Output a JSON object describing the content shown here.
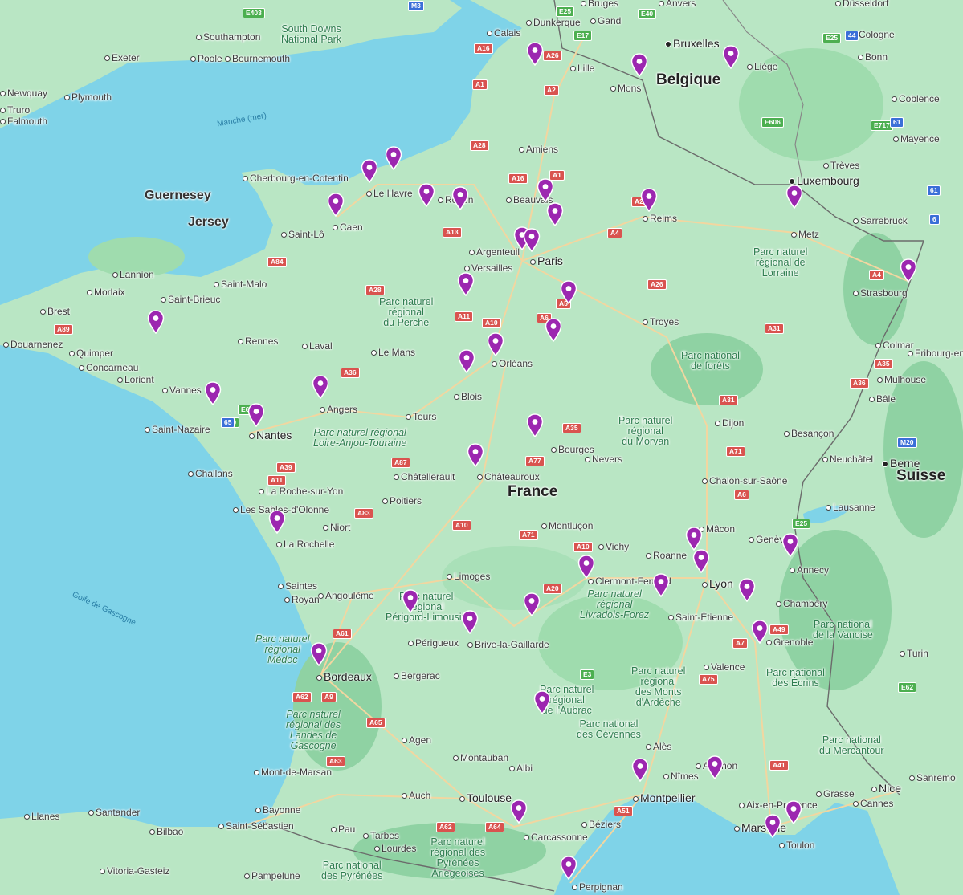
{
  "map": {
    "countries": [
      {
        "name": "France"
      },
      {
        "name": "Belgique"
      },
      {
        "name": "Suisse"
      }
    ],
    "islands": [
      {
        "name": "Guernesey"
      },
      {
        "name": "Jersey"
      }
    ],
    "cities": [
      {
        "name": "Paris",
        "style": "big"
      },
      {
        "name": "Lyon",
        "style": "big"
      },
      {
        "name": "Marseille",
        "style": "big"
      },
      {
        "name": "Toulouse",
        "style": "big"
      },
      {
        "name": "Nantes",
        "style": "big"
      },
      {
        "name": "Bordeaux",
        "style": "big"
      },
      {
        "name": "Montpellier",
        "style": "big"
      },
      {
        "name": "Nice",
        "style": "big"
      },
      {
        "name": "Bruxelles",
        "style": "cap"
      },
      {
        "name": "Luxembourg",
        "style": "cap"
      },
      {
        "name": "Berne",
        "style": "cap"
      },
      {
        "name": "Lille"
      },
      {
        "name": "Rouen"
      },
      {
        "name": "Le Havre"
      },
      {
        "name": "Caen"
      },
      {
        "name": "Reims"
      },
      {
        "name": "Metz"
      },
      {
        "name": "Strasbourg"
      },
      {
        "name": "Amiens"
      },
      {
        "name": "Calais"
      },
      {
        "name": "Dunkerque"
      },
      {
        "name": "Gand"
      },
      {
        "name": "Anvers"
      },
      {
        "name": "Bruges"
      },
      {
        "name": "Mons"
      },
      {
        "name": "Liège"
      },
      {
        "name": "Düsseldorf"
      },
      {
        "name": "Cologne"
      },
      {
        "name": "Bonn"
      },
      {
        "name": "Coblence"
      },
      {
        "name": "Mayence"
      },
      {
        "name": "Trèves"
      },
      {
        "name": "Sarrebruck"
      },
      {
        "name": "Cherbourg-en-Cotentin"
      },
      {
        "name": "Saint-Lô"
      },
      {
        "name": "Beauvais"
      },
      {
        "name": "Argenteuil"
      },
      {
        "name": "Versailles"
      },
      {
        "name": "Troyes"
      },
      {
        "name": "Orléans"
      },
      {
        "name": "Blois"
      },
      {
        "name": "Tours"
      },
      {
        "name": "Le Mans"
      },
      {
        "name": "Laval"
      },
      {
        "name": "Rennes"
      },
      {
        "name": "Angers"
      },
      {
        "name": "Brest"
      },
      {
        "name": "Morlaix"
      },
      {
        "name": "Lannion"
      },
      {
        "name": "Saint-Brieuc"
      },
      {
        "name": "Saint-Malo"
      },
      {
        "name": "Quimper"
      },
      {
        "name": "Concarneau"
      },
      {
        "name": "Lorient"
      },
      {
        "name": "Vannes"
      },
      {
        "name": "Douarnenez"
      },
      {
        "name": "Saint-Nazaire"
      },
      {
        "name": "Challans"
      },
      {
        "name": "La Roche-sur-Yon"
      },
      {
        "name": "Les Sables-d'Olonne"
      },
      {
        "name": "La Rochelle"
      },
      {
        "name": "Niort"
      },
      {
        "name": "Poitiers"
      },
      {
        "name": "Châtellerault"
      },
      {
        "name": "Châteauroux"
      },
      {
        "name": "Bourges"
      },
      {
        "name": "Nevers"
      },
      {
        "name": "Dijon"
      },
      {
        "name": "Besançon"
      },
      {
        "name": "Colmar"
      },
      {
        "name": "Mulhouse"
      },
      {
        "name": "Bâle"
      },
      {
        "name": "Fribourg-en-B."
      },
      {
        "name": "Neuchâtel"
      },
      {
        "name": "Lausanne"
      },
      {
        "name": "Genève"
      },
      {
        "name": "Annecy"
      },
      {
        "name": "Chambéry"
      },
      {
        "name": "Grenoble"
      },
      {
        "name": "Turin"
      },
      {
        "name": "Valence"
      },
      {
        "name": "Saint-Étienne"
      },
      {
        "name": "Roanne"
      },
      {
        "name": "Mâcon"
      },
      {
        "name": "Chalon-sur-Saône"
      },
      {
        "name": "Vichy"
      },
      {
        "name": "Clermont-Ferrand"
      },
      {
        "name": "Montluçon"
      },
      {
        "name": "Limoges"
      },
      {
        "name": "Angoulême"
      },
      {
        "name": "Saintes"
      },
      {
        "name": "Royan"
      },
      {
        "name": "Périgueux"
      },
      {
        "name": "Brive-la-Gaillarde"
      },
      {
        "name": "Bergerac"
      },
      {
        "name": "Agen"
      },
      {
        "name": "Montauban"
      },
      {
        "name": "Albi"
      },
      {
        "name": "Auch"
      },
      {
        "name": "Mont-de-Marsan"
      },
      {
        "name": "Bayonne"
      },
      {
        "name": "Pau"
      },
      {
        "name": "Tarbes"
      },
      {
        "name": "Lourdes"
      },
      {
        "name": "Carcassonne"
      },
      {
        "name": "Béziers"
      },
      {
        "name": "Perpignan"
      },
      {
        "name": "Nîmes"
      },
      {
        "name": "Avignon"
      },
      {
        "name": "Alès"
      },
      {
        "name": "Aix-en-Provence"
      },
      {
        "name": "Toulon"
      },
      {
        "name": "Grasse"
      },
      {
        "name": "Cannes"
      },
      {
        "name": "Sanremo"
      },
      {
        "name": "Santander"
      },
      {
        "name": "Bilbao"
      },
      {
        "name": "Saint-Sébastien"
      },
      {
        "name": "Vitoria-Gasteiz"
      },
      {
        "name": "Pampelune"
      },
      {
        "name": "Llanes"
      },
      {
        "name": "Southampton"
      },
      {
        "name": "Exeter"
      },
      {
        "name": "Poole"
      },
      {
        "name": "Bournemouth"
      },
      {
        "name": "Plymouth"
      },
      {
        "name": "Newquay"
      },
      {
        "name": "Truro"
      },
      {
        "name": "Falmouth"
      }
    ],
    "parks": [
      {
        "name": "South Downs\nNational Park"
      },
      {
        "name": "Parc naturel\nrégional de\nLorraine"
      },
      {
        "name": "Parc naturel\nrégional\ndu Perche"
      },
      {
        "name": "Parc national\nde forêts"
      },
      {
        "name": "Parc naturel\nrégional\ndu Morvan"
      },
      {
        "name": "Parc naturel régional\nLoire-Anjou-Touraine",
        "italic": true
      },
      {
        "name": "Parc naturel\nrégional\nPérigord-Limousin"
      },
      {
        "name": "Parc naturel\nrégional\nLivradois-Forez",
        "italic": true
      },
      {
        "name": "Parc naturel\nrégional\nMédoc",
        "italic": true
      },
      {
        "name": "Parc naturel\nrégional des\nLandes de\nGascogne",
        "italic": true
      },
      {
        "name": "Parc naturel\nrégional\nde l'Aubrac"
      },
      {
        "name": "Parc naturel\nrégional\ndes Monts\nd'Ardèche"
      },
      {
        "name": "Parc national\ndes Cévennes"
      },
      {
        "name": "Parc national\nde la Vanoise"
      },
      {
        "name": "Parc national\ndes Écrins"
      },
      {
        "name": "Parc national\ndu Mercantour"
      },
      {
        "name": "Parc naturel\nrégional des\nPyrénées\nAriégeoises"
      },
      {
        "name": "Parc national\ndes Pyrénées"
      }
    ],
    "seas": [
      {
        "name": "Manche (mer)"
      },
      {
        "name": "Golfe de Gascogne"
      }
    ],
    "roads": [
      "A16",
      "A26",
      "A1",
      "A2",
      "A28",
      "A16",
      "A1",
      "A26",
      "A4",
      "A13",
      "A84",
      "A28",
      "A11",
      "A10",
      "A6",
      "A5",
      "A26",
      "A31",
      "A4",
      "A35",
      "A36",
      "A31",
      "A35",
      "A77",
      "A71",
      "A6",
      "A36",
      "A39",
      "A11",
      "A87",
      "A83",
      "A10",
      "A10",
      "A20",
      "A71",
      "A89",
      "E62",
      "E60",
      "E3",
      "A75",
      "A7",
      "A49",
      "A41",
      "A51",
      "A9",
      "A62",
      "A63",
      "A65",
      "A62",
      "A64",
      "A61",
      "E606",
      "E25",
      "E40",
      "E17",
      "E403",
      "M3",
      "M20",
      "E25",
      "E62",
      "E717",
      "E25",
      "44",
      "61",
      "61",
      "6",
      "65",
      "E60"
    ],
    "markers_count": 46,
    "marker_color": "#9c27b0",
    "water_color": "#7fd3e8",
    "land_color": "#b9e6c4",
    "forest_color": "#8fd2a3"
  }
}
